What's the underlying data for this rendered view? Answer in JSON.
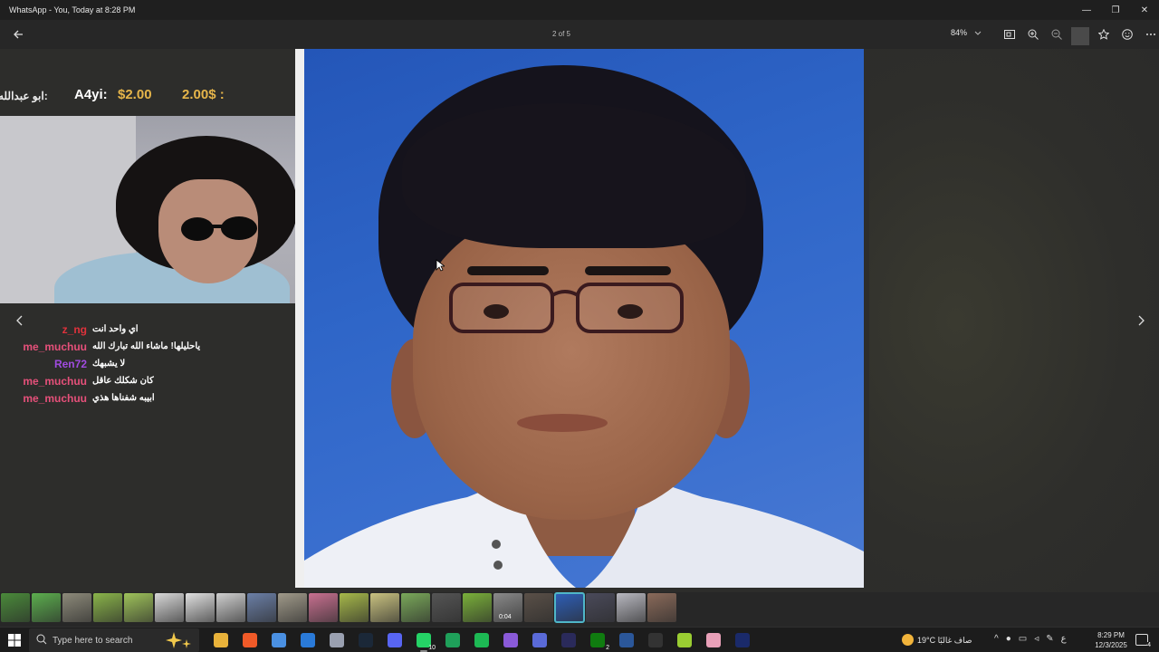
{
  "window": {
    "title": "WhatsApp - You, Today at 8:28 PM",
    "minimize": "—",
    "restore": "❐",
    "close": "✕"
  },
  "toolbar": {
    "page_counter": "2 of 5",
    "zoom": "84%",
    "icons": [
      "back-arrow-icon",
      "fit-icon",
      "zoom-in-icon",
      "zoom-out-icon",
      "star-icon",
      "emoji-icon",
      "more-icon"
    ]
  },
  "stream": {
    "donation": {
      "arabic": "ابو عبدالله:",
      "user": "A4yi:",
      "amount": "$2.00",
      "amount2": "2.00$ :"
    },
    "chat": [
      {
        "user": "z_ng",
        "color": "#e0323c",
        "message": "اي واحد انت"
      },
      {
        "user": "me_muchuu",
        "color": "#e6507a",
        "message": "ياحليلها! ماشاء الله تبارك الله"
      },
      {
        "user": "Ren72",
        "color": "#a04be0",
        "message": "لا يشبهك"
      },
      {
        "user": "me_muchuu",
        "color": "#e6507a",
        "message": "كان شكلك عاقل"
      },
      {
        "user": "me_muchuu",
        "color": "#e6507a",
        "message": "ابيبه شفناها هذي"
      }
    ]
  },
  "thumbnails": [
    {
      "color": "#4a8a3a"
    },
    {
      "color": "#5cae4e"
    },
    {
      "color": "#8d8a7a"
    },
    {
      "color": "#8ab44a"
    },
    {
      "color": "#9ec25a"
    },
    {
      "color": "#d8d8d8"
    },
    {
      "color": "#e0e0e0"
    },
    {
      "color": "#cfcfcf"
    },
    {
      "color": "#6b7fa6"
    },
    {
      "color": "#a09a8a"
    },
    {
      "color": "#c87090"
    },
    {
      "color": "#a6b84a"
    },
    {
      "color": "#c9c280"
    },
    {
      "color": "#7aa85a"
    },
    {
      "color": "#555555"
    },
    {
      "color": "#7ab03a"
    },
    {
      "color": "#8a8a8a",
      "duration": "0:04"
    },
    {
      "color": "#5a5048"
    },
    {
      "color": "#2e5fb8",
      "active": true
    },
    {
      "color": "#4a4a5a"
    },
    {
      "color": "#b8b8c0"
    },
    {
      "color": "#8a6a5a"
    }
  ],
  "taskbar": {
    "search_placeholder": "Type here to search",
    "apps": [
      {
        "name": "file-explorer-icon",
        "color": "#e8b23a"
      },
      {
        "name": "brave-icon",
        "color": "#f05a28"
      },
      {
        "name": "store-icon",
        "color": "#4a90e2"
      },
      {
        "name": "app-blue-icon",
        "color": "#2a7ad8"
      },
      {
        "name": "app-circle-icon",
        "color": "#9aa0b0"
      },
      {
        "name": "steam-icon",
        "color": "#1b2838"
      },
      {
        "name": "discord-icon",
        "color": "#5865f2"
      },
      {
        "name": "whatsapp-icon",
        "color": "#25d366",
        "badge": "10",
        "open": true
      },
      {
        "name": "app-green-icon",
        "color": "#1fa05a"
      },
      {
        "name": "spotify-icon",
        "color": "#1db954"
      },
      {
        "name": "app-purple-icon",
        "color": "#8a5ad8"
      },
      {
        "name": "app-diamond-icon",
        "color": "#5a6ad8"
      },
      {
        "name": "app-dark-icon",
        "color": "#2a2a5a"
      },
      {
        "name": "xbox-icon",
        "color": "#107c10",
        "badge": "2"
      },
      {
        "name": "word-icon",
        "color": "#2b579a"
      },
      {
        "name": "xdpen-icon",
        "color": "#333333"
      },
      {
        "name": "app-lime-icon",
        "color": "#9acd32"
      },
      {
        "name": "app-pink-icon",
        "color": "#e8a0b8"
      },
      {
        "name": "fresco-icon",
        "color": "#1a2a6a"
      }
    ],
    "weather": "19°C  صاف غالبًا",
    "language": "ع",
    "time": "8:29 PM",
    "date": "12/3/2025",
    "notifications": "4"
  }
}
